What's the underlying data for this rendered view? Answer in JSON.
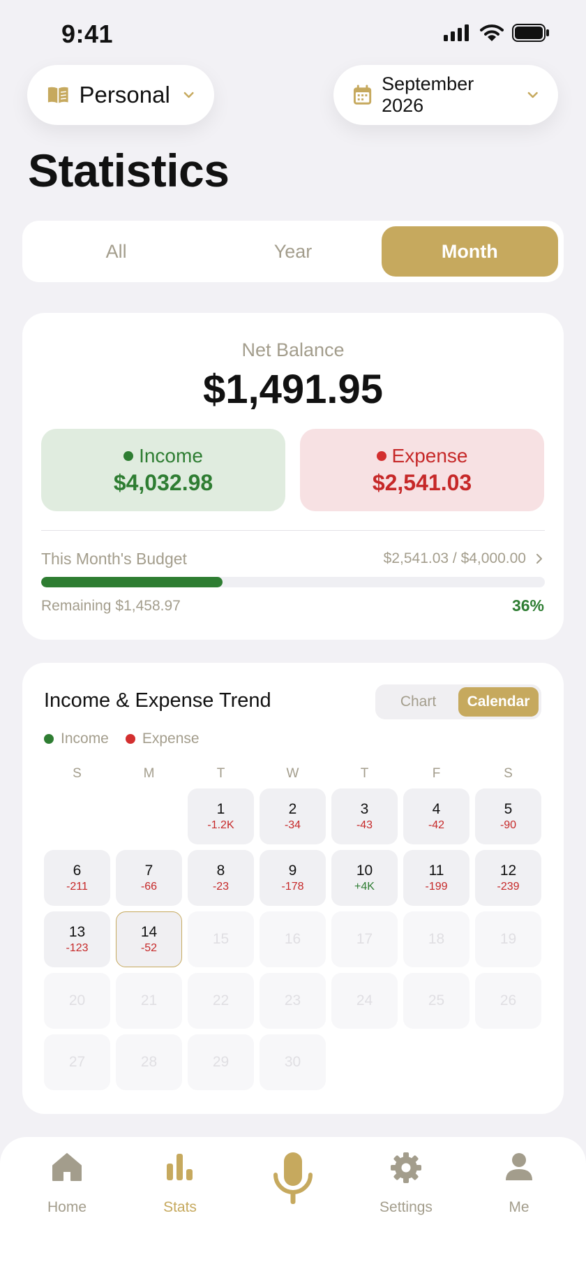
{
  "status_bar": {
    "time": "9:41"
  },
  "book_selector": {
    "label": "Personal"
  },
  "date_selector": {
    "label": "September 2026"
  },
  "page_title": "Statistics",
  "segments": [
    {
      "label": "All",
      "active": false
    },
    {
      "label": "Year",
      "active": false
    },
    {
      "label": "Month",
      "active": true
    }
  ],
  "balance": {
    "net_label": "Net Balance",
    "net_value": "$1,491.95",
    "income_label": "Income",
    "income_value": "$4,032.98",
    "expense_label": "Expense",
    "expense_value": "$2,541.03"
  },
  "budget": {
    "label": "This Month's Budget",
    "amount": "$2,541.03 / $4,000.00",
    "remaining_label": "Remaining",
    "remaining_value": "$1,458.97",
    "percent": "36%",
    "progress": 0.36
  },
  "trend": {
    "title": "Income & Expense Trend",
    "view_chart": "Chart",
    "view_calendar": "Calendar",
    "legend_income": "Income",
    "legend_expense": "Expense",
    "weekdays": [
      "S",
      "M",
      "T",
      "W",
      "T",
      "F",
      "S"
    ],
    "leading_blanks": 2,
    "days": [
      {
        "day": "1",
        "amount": "-1.2K"
      },
      {
        "day": "2",
        "amount": "-34"
      },
      {
        "day": "3",
        "amount": "-43"
      },
      {
        "day": "4",
        "amount": "-42"
      },
      {
        "day": "5",
        "amount": "-90"
      },
      {
        "day": "6",
        "amount": "-211"
      },
      {
        "day": "7",
        "amount": "-66"
      },
      {
        "day": "8",
        "amount": "-23"
      },
      {
        "day": "9",
        "amount": "-178"
      },
      {
        "day": "10",
        "amount": "+4K"
      },
      {
        "day": "11",
        "amount": "-199"
      },
      {
        "day": "12",
        "amount": "-239"
      },
      {
        "day": "13",
        "amount": "-123"
      },
      {
        "day": "14",
        "amount": "-52",
        "today": true
      },
      {
        "day": "15",
        "future": true
      },
      {
        "day": "16",
        "future": true
      },
      {
        "day": "17",
        "future": true
      },
      {
        "day": "18",
        "future": true
      },
      {
        "day": "19",
        "future": true
      },
      {
        "day": "20",
        "future": true
      },
      {
        "day": "21",
        "future": true
      },
      {
        "day": "22",
        "future": true
      },
      {
        "day": "23",
        "future": true
      },
      {
        "day": "24",
        "future": true
      },
      {
        "day": "25",
        "future": true
      },
      {
        "day": "26",
        "future": true
      },
      {
        "day": "27",
        "future": true
      },
      {
        "day": "28",
        "future": true
      },
      {
        "day": "29",
        "future": true
      },
      {
        "day": "30",
        "future": true
      }
    ]
  },
  "tabs": [
    {
      "label": "Home",
      "icon": "home-icon"
    },
    {
      "label": "Stats",
      "icon": "bar-chart-icon",
      "active": true
    },
    {
      "label": "",
      "icon": "microphone-icon"
    },
    {
      "label": "Settings",
      "icon": "gear-icon"
    },
    {
      "label": "Me",
      "icon": "person-icon"
    }
  ],
  "colors": {
    "accent": "#C6A95E",
    "income": "#2E7D32",
    "expense": "#C62828",
    "muted": "#A39D8C",
    "background": "#F2F1F5"
  }
}
